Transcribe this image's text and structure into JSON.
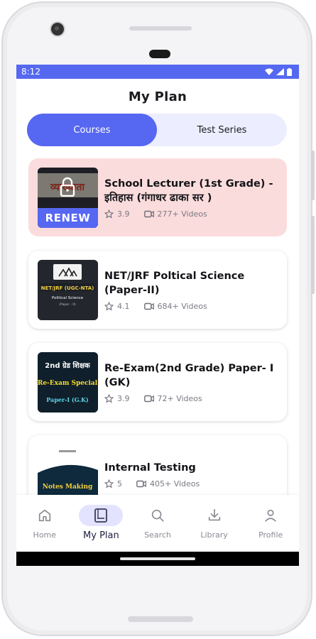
{
  "status_bar": {
    "time": "8:12"
  },
  "header": {
    "title": "My Plan"
  },
  "tabs": [
    {
      "label": "Courses",
      "active": true
    },
    {
      "label": "Test Series",
      "active": false
    }
  ],
  "courses": [
    {
      "title": "School Lecturer (1st Grade) - इतिहास (गंगाधर ढाका सर )",
      "rating": "3.9",
      "videos": "277+ Videos",
      "locked": true,
      "renew_label": "RENEW",
      "thumb_text": "व्याख्याता"
    },
    {
      "title": "NET/JRF Poltical Science (Paper-II)",
      "rating": "4.1",
      "videos": "684+ Videos",
      "thumb_text": "NET/JRF (UGC-NTA)",
      "thumb_subtext": "Political Science",
      "thumb_paper": "(Paper - II)"
    },
    {
      "title": "Re-Exam(2nd Grade) Paper- I (GK)",
      "rating": "3.9",
      "videos": "72+ Videos",
      "thumb_text": "2nd ग्रेड शिक्षक",
      "thumb_subtext": "Re-Exam Special",
      "thumb_paper": "Paper-I (G.K)"
    },
    {
      "title": "Internal Testing",
      "rating": "5",
      "videos": "405+ Videos",
      "thumb_text": "Notes Making"
    }
  ],
  "bottom_nav": [
    {
      "label": "Home",
      "icon": "home-icon",
      "active": false
    },
    {
      "label": "My Plan",
      "icon": "book-icon",
      "active": true
    },
    {
      "label": "Search",
      "icon": "search-icon",
      "active": false
    },
    {
      "label": "Library",
      "icon": "download-icon",
      "active": false
    },
    {
      "label": "Profile",
      "icon": "person-icon",
      "active": false
    }
  ],
  "colors": {
    "accent": "#5667f2",
    "status_bar": "#5568f0",
    "expired_card": "#fbdcdc",
    "tab_track": "#eceeff"
  }
}
